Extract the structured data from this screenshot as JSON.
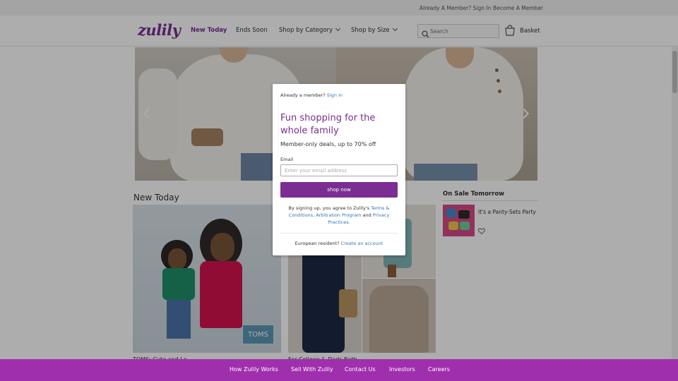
{
  "topbar": {
    "sign_in_prompt": "Already A Member? Sign In",
    "become_member": "Become A Member"
  },
  "header": {
    "logo": "zulily",
    "nav": [
      {
        "label": "New Today",
        "active": true
      },
      {
        "label": "Ends Soon",
        "active": false
      },
      {
        "label": "Shop by Category",
        "active": false
      },
      {
        "label": "Shop by Size",
        "active": false
      }
    ],
    "search_placeholder": "Search",
    "basket_label": "Basket"
  },
  "main": {
    "new_today_title": "New Today",
    "feature_brand_tag": "TOMS",
    "feature_caption": "TOMS: Cute and Lo...",
    "grid_caption": "For Colleen & Dads Both...",
    "on_sale_tomorrow": {
      "title": "On Sale Tomorrow",
      "items": [
        {
          "label": "It's a Panty-Sets Party"
        }
      ]
    }
  },
  "modal": {
    "already_text": "Already a member?",
    "sign_in_link": "Sign in",
    "headline": "Fun shopping for the whole family",
    "subhead": "Member-only deals, up to 70% off",
    "email_label": "Email",
    "email_placeholder": "Enter your email address",
    "cta": "shop now",
    "legal_prefix": "By signing up, you agree to Zulily's",
    "terms_link": "Terms & Conditions, Arbitration Program",
    "legal_and": "and",
    "privacy_link": "Privacy Practices.",
    "eu_prompt": "European resident?",
    "eu_link": "Create an account"
  },
  "footer": {
    "links": [
      "How Zulily Works",
      "Sell With Zulily",
      "Contact Us",
      "Investors",
      "Careers"
    ]
  },
  "colors": {
    "brand_purple": "#7b2d92",
    "footer_purple": "#a02fad",
    "link_blue": "#3173b7"
  }
}
